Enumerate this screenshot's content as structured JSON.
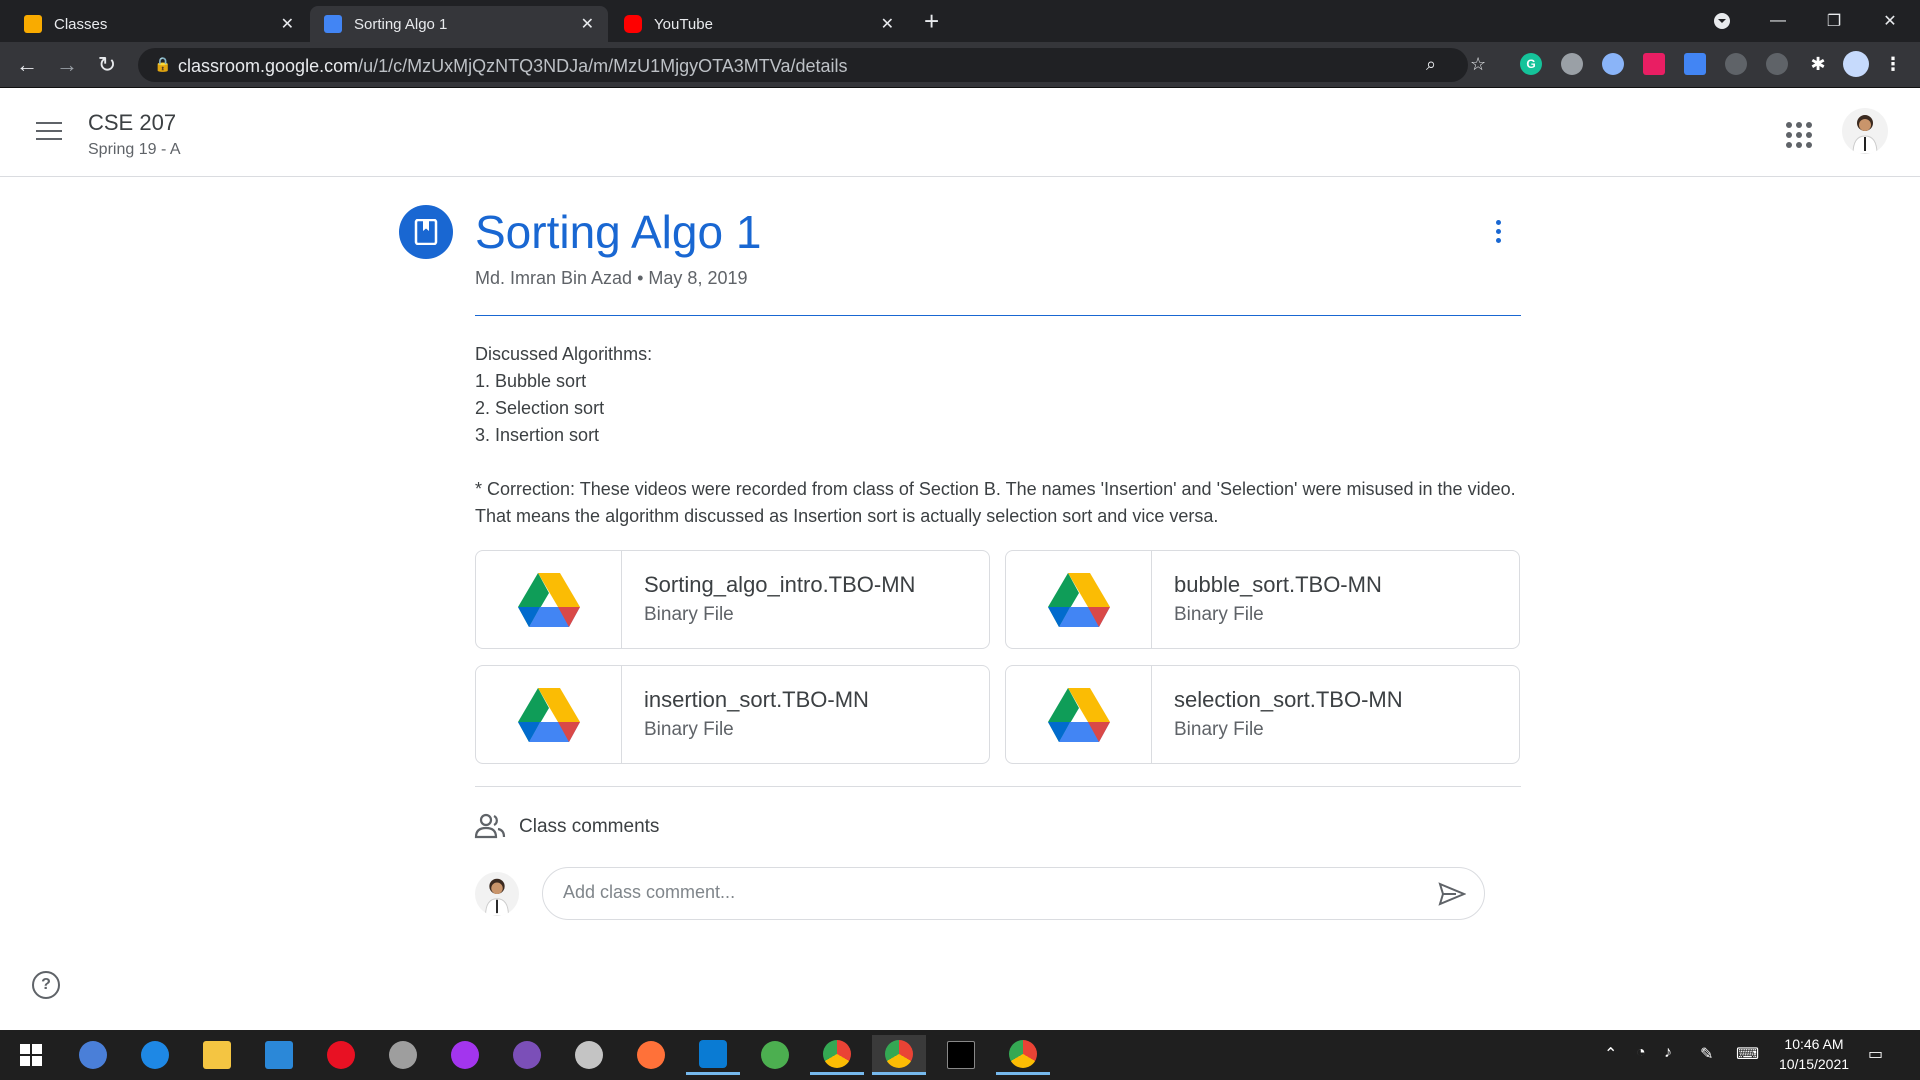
{
  "browser": {
    "tabs": [
      {
        "title": "Classes",
        "favicon_color": "#f9ab00"
      },
      {
        "title": "Sorting Algo 1",
        "favicon_color": "#4285f4",
        "active": true
      },
      {
        "title": "YouTube",
        "favicon_color": "#ff0000"
      }
    ],
    "url_host": "classroom.google.com",
    "url_path": "/u/1/c/MzUxMjQzNTQ3NDJa/m/MzU1MjgyOTA3MTVa/details"
  },
  "header": {
    "course_title": "CSE 207",
    "course_section": "Spring 19 - A"
  },
  "post": {
    "title": "Sorting Algo 1",
    "author": "Md. Imran Bin Azad",
    "separator": "•",
    "date": "May 8, 2019",
    "body": [
      "Discussed Algorithms:",
      "1. Bubble sort",
      "2. Selection sort",
      "3. Insertion sort",
      "",
      "* Correction: These videos were recorded from class of Section B. The names 'Insertion' and 'Selection' were misused in the video. That means the algorithm discussed as Insertion sort is actually selection sort and vice versa."
    ],
    "attachments": [
      {
        "name": "Sorting_algo_intro.TBO-MN",
        "type": "Binary File",
        "icon": "google-drive-icon"
      },
      {
        "name": "bubble_sort.TBO-MN",
        "type": "Binary File",
        "icon": "google-drive-icon"
      },
      {
        "name": "insertion_sort.TBO-MN",
        "type": "Binary File",
        "icon": "google-drive-icon"
      },
      {
        "name": "selection_sort.TBO-MN",
        "type": "Binary File",
        "icon": "google-drive-icon"
      }
    ]
  },
  "comments": {
    "label": "Class comments",
    "placeholder": "Add class comment..."
  },
  "taskbar": {
    "time": "10:46 AM",
    "date": "10/15/2021"
  },
  "colors": {
    "accent": "#1967d2",
    "browser_dark": "#202124",
    "browser_toolbar": "#35363a"
  }
}
